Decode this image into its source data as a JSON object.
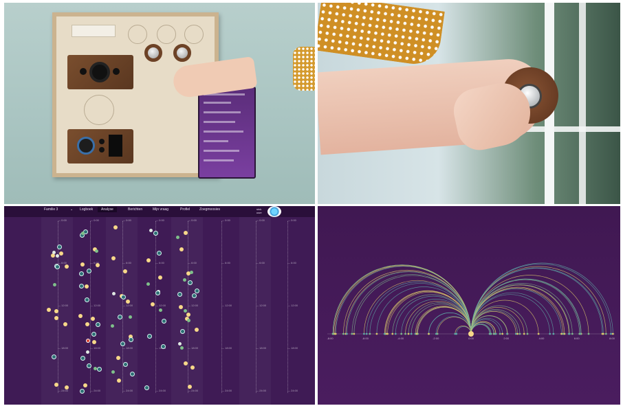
{
  "analysis_ui": {
    "nav": {
      "family": "Familie 3",
      "items": [
        "Logboek",
        "Analyse",
        "Berichten",
        "Mijn vraag",
        "Profiel",
        "Zoegmoosies"
      ],
      "active": "Analyse",
      "user": "stok user"
    },
    "time_ticks": [
      "0:00",
      "6:00",
      "12:00",
      "18:00",
      "24:00"
    ],
    "column_count": 8
  },
  "arc_chart": {
    "axis_ticks": [
      "-8:00",
      "-6:00",
      "-4:00",
      "-2:00",
      "0:00",
      "2:00",
      "4:00",
      "6:00",
      "8:00"
    ],
    "colors": {
      "background": "#401852",
      "arc_yellow": "#d9c86a",
      "arc_green": "#7fb98d",
      "arc_teal": "#5fa8a6",
      "center": "#f7d889"
    }
  },
  "colors": {
    "purple_bg": "#3f1b55",
    "dot_yellow": "#f7d889",
    "dot_green": "#7fc08a",
    "dot_teal": "#2c6f74",
    "dot_red": "#d9412f"
  }
}
